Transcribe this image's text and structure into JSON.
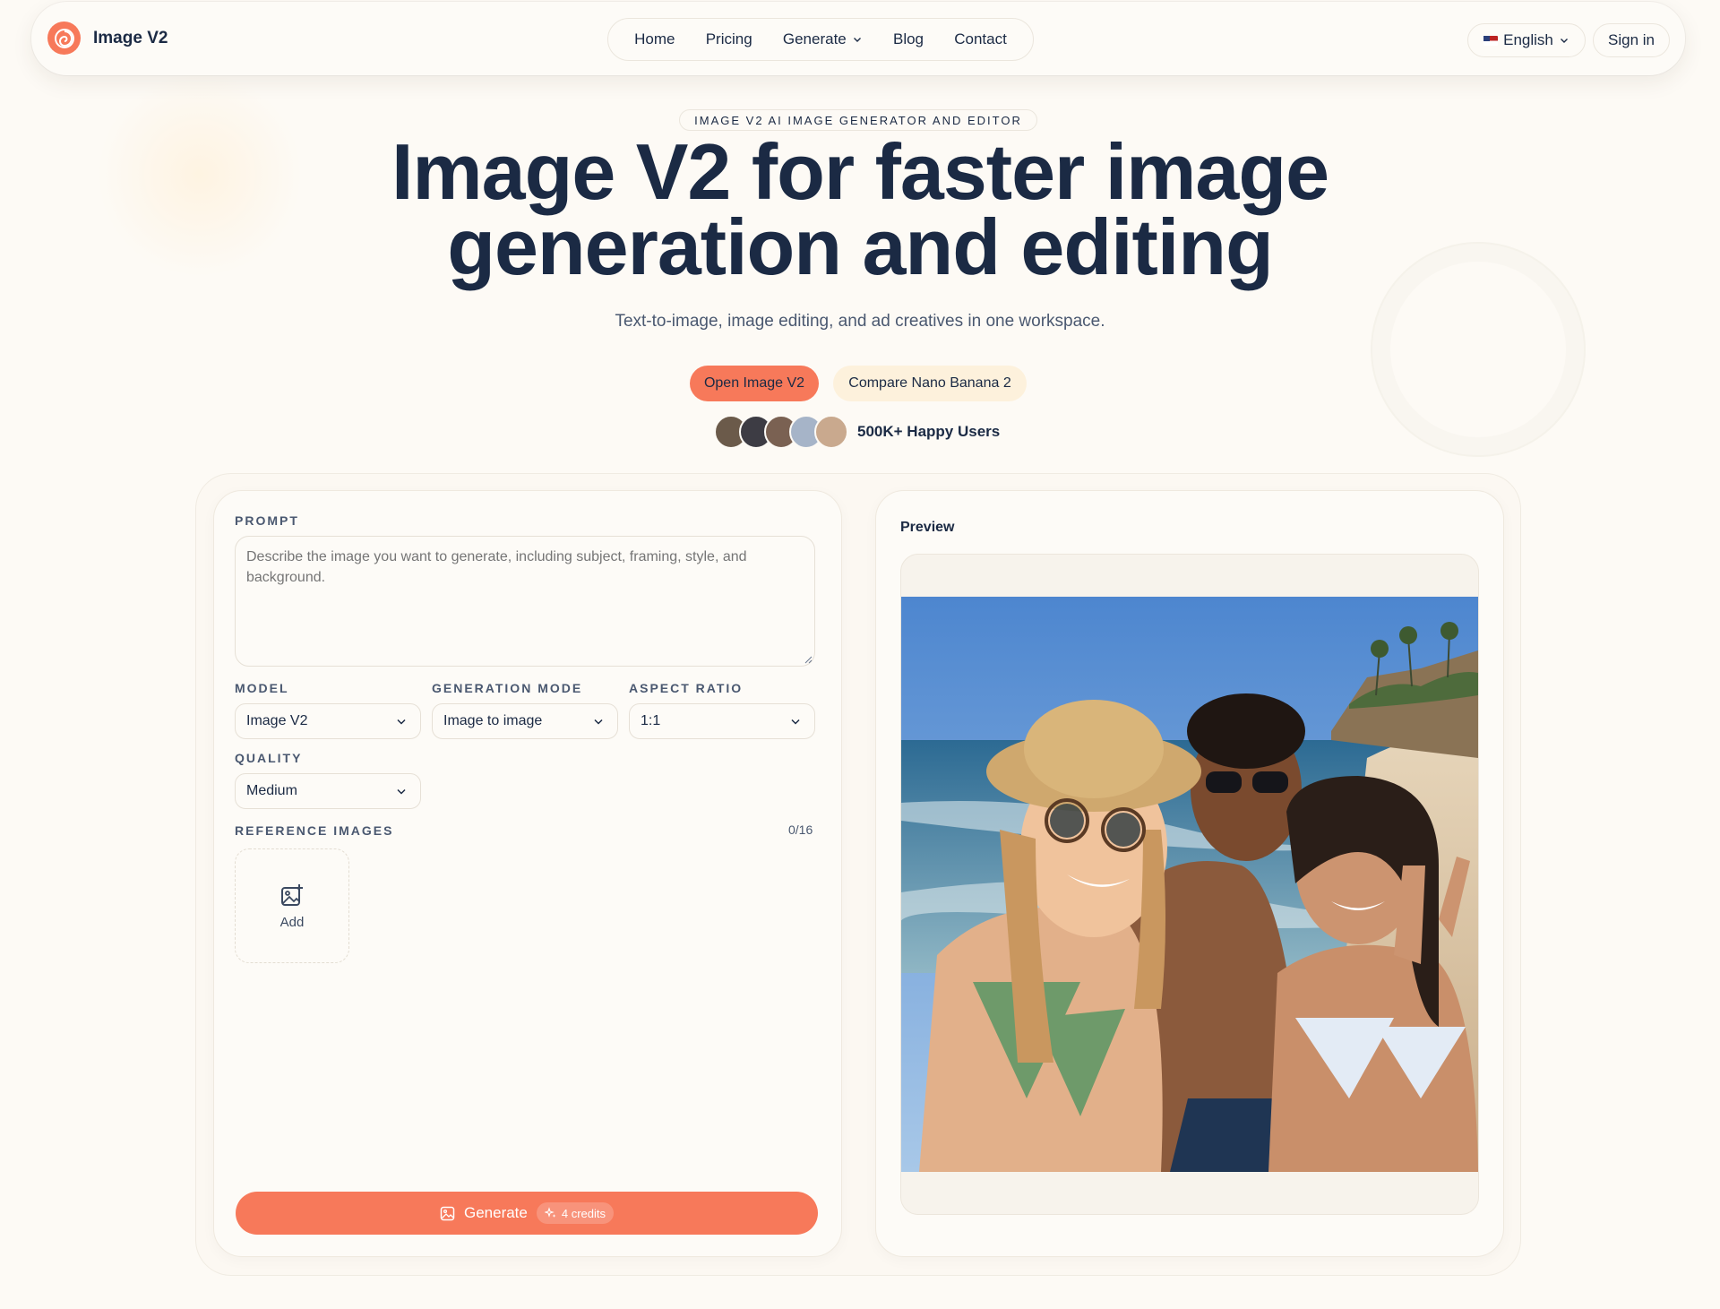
{
  "brand": {
    "name": "Image V2"
  },
  "nav": {
    "items": [
      {
        "label": "Home"
      },
      {
        "label": "Pricing"
      },
      {
        "label": "Generate",
        "has_dropdown": true
      },
      {
        "label": "Blog"
      },
      {
        "label": "Contact"
      }
    ],
    "language": "English",
    "sign_in": "Sign in"
  },
  "hero": {
    "eyebrow": "IMAGE V2 AI IMAGE GENERATOR AND EDITOR",
    "title_line1": "Image V2 for faster image",
    "title_line2": "generation and editing",
    "subtitle": "Text-to-image, image editing, and ad creatives in one workspace.",
    "primary_cta": "Open Image V2",
    "secondary_cta": "Compare Nano Banana 2",
    "social_proof": "500K+ Happy Users"
  },
  "form": {
    "prompt_label": "PROMPT",
    "prompt_placeholder": "Describe the image you want to generate, including subject, framing, style, and background.",
    "model_label": "MODEL",
    "model_value": "Image V2",
    "mode_label": "GENERATION MODE",
    "mode_value": "Image to image",
    "aspect_label": "ASPECT RATIO",
    "aspect_value": "1:1",
    "quality_label": "QUALITY",
    "quality_value": "Medium",
    "reference_label": "REFERENCE IMAGES",
    "reference_count": "0/16",
    "add_label": "Add",
    "generate_label": "Generate",
    "credits_label": "4 credits"
  },
  "preview": {
    "label": "Preview"
  },
  "colors": {
    "accent": "#f7795a",
    "text": "#1b2a44",
    "background": "#fdfaf5"
  }
}
